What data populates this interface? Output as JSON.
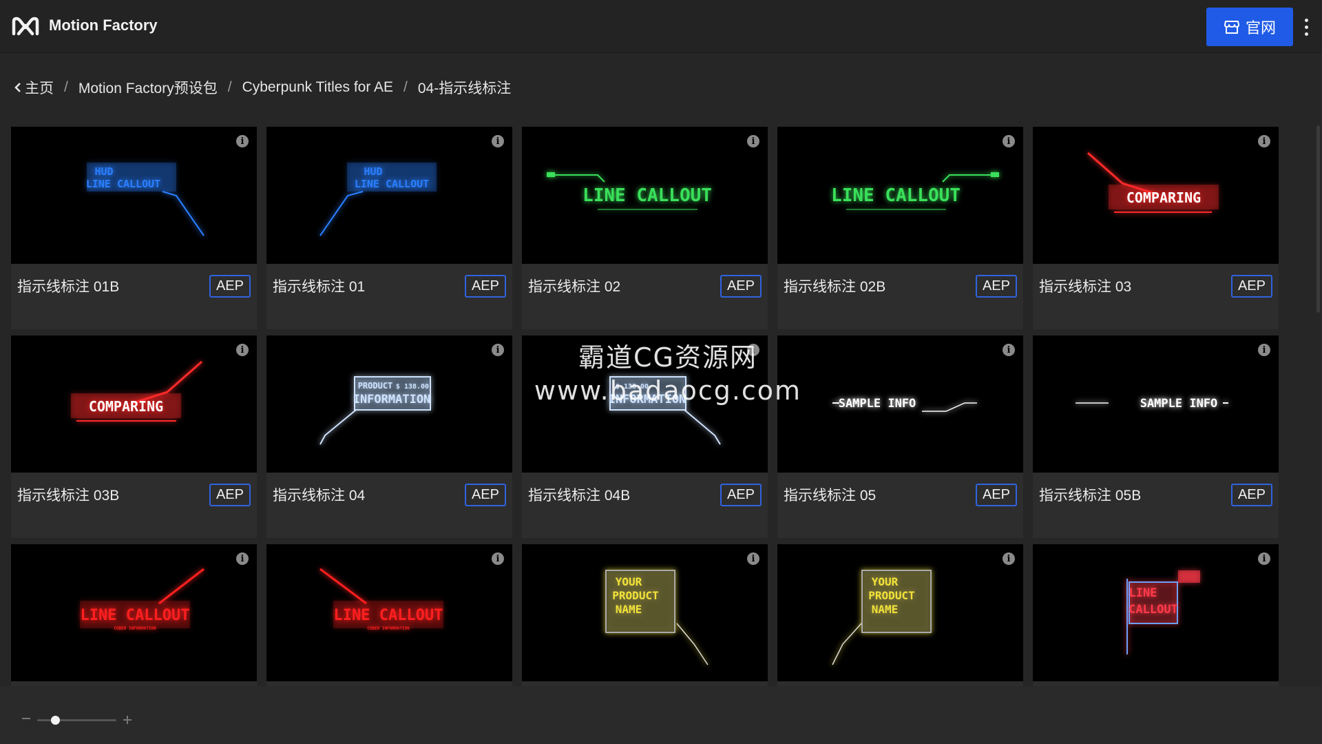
{
  "app": {
    "title": "Motion Factory",
    "site_button_label": "官网"
  },
  "breadcrumb": [
    "主页",
    "Motion Factory预设包",
    "Cyberpunk Titles for AE",
    "04-指示线标注"
  ],
  "badge_label": "AEP",
  "cards": [
    {
      "title": "指示线标注 01B",
      "thumb_text": [
        "HUD",
        "LINE CALLOUT"
      ],
      "color": "#2a7fff"
    },
    {
      "title": "指示线标注 01",
      "thumb_text": [
        "HUD",
        "LINE CALLOUT"
      ],
      "color": "#2a7fff"
    },
    {
      "title": "指示线标注 02",
      "thumb_text": [
        "LINE CALLOUT"
      ],
      "color": "#3ae05a"
    },
    {
      "title": "指示线标注 02B",
      "thumb_text": [
        "LINE CALLOUT"
      ],
      "color": "#3ae05a"
    },
    {
      "title": "指示线标注 03",
      "thumb_text": [
        "COMPARING"
      ],
      "color": "#ff2a2a"
    },
    {
      "title": "指示线标注 03B",
      "thumb_text": [
        "COMPARING"
      ],
      "color": "#ff2a2a"
    },
    {
      "title": "指示线标注 04",
      "thumb_text": [
        "PRODUCT",
        "$ 138.00",
        "INFORMATION"
      ],
      "color": "#cfe3ff"
    },
    {
      "title": "指示线标注 04B",
      "thumb_text": [
        "$ 138.00",
        "INFORMATION"
      ],
      "color": "#cfe3ff"
    },
    {
      "title": "指示线标注 05",
      "thumb_text": [
        "SAMPLE INFO"
      ],
      "color": "#ffffff"
    },
    {
      "title": "指示线标注 05B",
      "thumb_text": [
        "SAMPLE INFO"
      ],
      "color": "#ffffff"
    },
    {
      "title": "",
      "thumb_text": [
        "LINE CALLOUT",
        "CUBER INFORMATION"
      ],
      "color": "#ff1f1f"
    },
    {
      "title": "",
      "thumb_text": [
        "LINE CALLOUT",
        "CUBER INFORMATION"
      ],
      "color": "#ff1f1f"
    },
    {
      "title": "",
      "thumb_text": [
        "YOUR",
        "PRODUCT",
        "NAME"
      ],
      "color": "#f2e23a"
    },
    {
      "title": "",
      "thumb_text": [
        "YOUR",
        "PRODUCT",
        "NAME"
      ],
      "color": "#f2e23a"
    },
    {
      "title": "",
      "thumb_text": [
        "LINE",
        "CALLOUT"
      ],
      "color": "#ff3a4a"
    }
  ],
  "watermark": {
    "line1": "霸道CG资源网",
    "line2": "www.badaocg.com"
  }
}
